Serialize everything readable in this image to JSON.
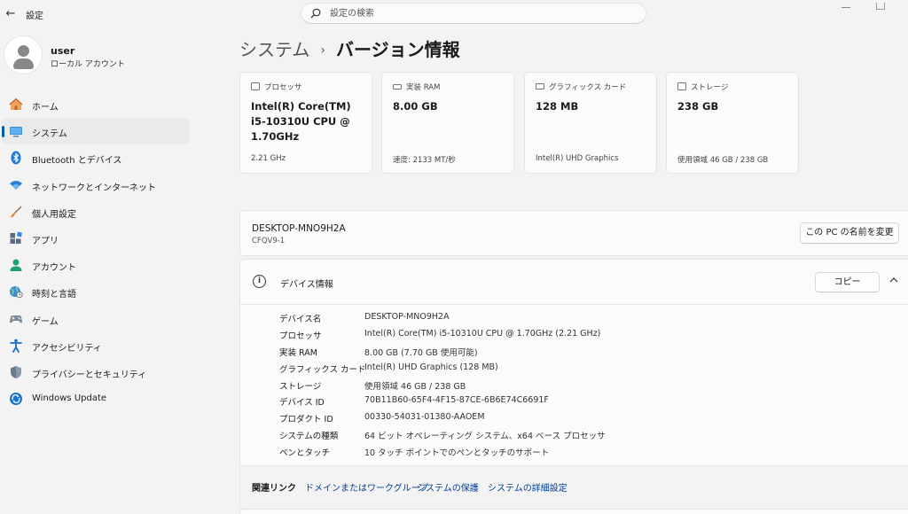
{
  "window": {
    "title": "設定",
    "back_glyph": "←"
  },
  "search": {
    "placeholder": "設定の検索"
  },
  "profile": {
    "name": "user",
    "account_type": "ローカル アカウント"
  },
  "sidebar": {
    "items": [
      {
        "label": "ホーム",
        "icon": "home-icon"
      },
      {
        "label": "システム",
        "icon": "system-display-icon",
        "active": true
      },
      {
        "label": "Bluetooth とデバイス",
        "icon": "bluetooth-icon"
      },
      {
        "label": "ネットワークとインターネット",
        "icon": "wifi-icon"
      },
      {
        "label": "個人用設定",
        "icon": "paintbrush-icon"
      },
      {
        "label": "アプリ",
        "icon": "apps-icon"
      },
      {
        "label": "アカウント",
        "icon": "account-icon"
      },
      {
        "label": "時刻と言語",
        "icon": "time-language-icon"
      },
      {
        "label": "ゲーム",
        "icon": "gaming-controller-icon"
      },
      {
        "label": "アクセシビリティ",
        "icon": "accessibility-icon"
      },
      {
        "label": "プライバシーとセキュリティ",
        "icon": "shield-icon"
      },
      {
        "label": "Windows Update",
        "icon": "windows-update-icon"
      }
    ]
  },
  "header": {
    "breadcrumb_parent": "システム",
    "separator": "›",
    "title": "バージョン情報"
  },
  "cards": [
    {
      "label": "プロセッサ",
      "value": "Intel(R) Core(TM) i5-10310U CPU @ 1.70GHz",
      "sub": "2.21 GHz",
      "icon": "processor-icon"
    },
    {
      "label": "実装 RAM",
      "value": "8.00 GB",
      "sub": "速度: 2133 MT/秒",
      "icon": "ram-icon"
    },
    {
      "label": "グラフィックス カード",
      "value": "128 MB",
      "sub": "Intel(R) UHD Graphics",
      "icon": "graphics-card-icon"
    },
    {
      "label": "ストレージ",
      "value": "238 GB",
      "sub": "使用領域 46 GB / 238 GB",
      "icon": "storage-icon"
    }
  ],
  "device": {
    "name": "DESKTOP-MNO9H2A",
    "model": "CFQV9-1",
    "rename_label": "この PC の名前を変更"
  },
  "device_info": {
    "title": "デバイス情報",
    "info_glyph": "i",
    "copy_label": "コピー",
    "rows": [
      {
        "label": "デバイス名",
        "value": "DESKTOP-MNO9H2A"
      },
      {
        "label": "プロセッサ",
        "value": "Intel(R) Core(TM) i5-10310U CPU @ 1.70GHz (2.21 GHz)"
      },
      {
        "label": "実装 RAM",
        "value": "8.00 GB (7.70 GB 使用可能)"
      },
      {
        "label": "グラフィックス カード",
        "value": "Intel(R) UHD Graphics (128 MB)"
      },
      {
        "label": "ストレージ",
        "value": "使用領域 46 GB / 238 GB"
      },
      {
        "label": "デバイス ID",
        "value": "70B11B60-65F4-4F15-87CE-6B6E74C6691F"
      },
      {
        "label": "プロダクト ID",
        "value": "00330-54031-01380-AAOEM"
      },
      {
        "label": "システムの種類",
        "value": "64 ビット オペレーティング システム、x64 ベース プロセッサ"
      },
      {
        "label": "ペンとタッチ",
        "value": "10 タッチ ポイントでのペンとタッチのサポート"
      }
    ]
  },
  "related": {
    "title": "関連リンク",
    "links": [
      "ドメインまたはワークグループ",
      "システムの保護",
      "システムの詳細設定"
    ]
  },
  "colors": {
    "accent": "#005fb8",
    "link": "#003e92",
    "background": "#f3f3f3",
    "card": "#fbfbfb"
  }
}
